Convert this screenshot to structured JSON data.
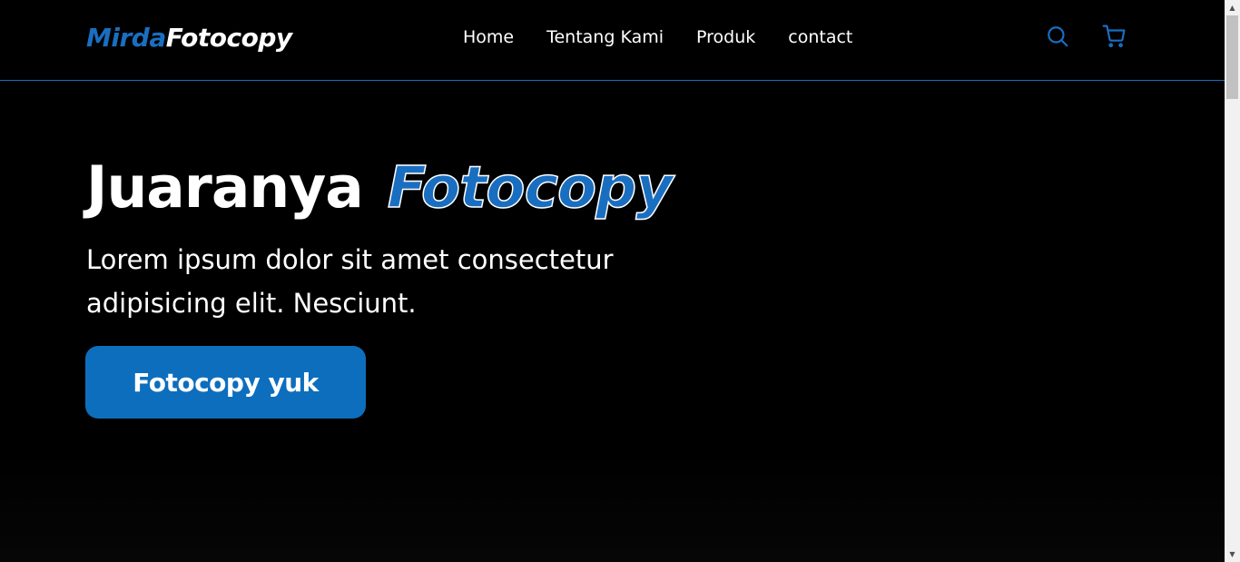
{
  "navbar": {
    "brand_part1": "Mirda",
    "brand_part2": "Fotocopy",
    "links": [
      {
        "label": "Home"
      },
      {
        "label": "Tentang Kami"
      },
      {
        "label": "Produk"
      },
      {
        "label": "contact"
      }
    ],
    "icons": [
      "search-icon",
      "shopping-cart-icon"
    ]
  },
  "hero": {
    "title_part1": "Juaranya",
    "title_part2": "Fotocopy",
    "text": "Lorem ipsum dolor sit amet consectetur adipisicing elit. Nesciunt.",
    "cta_label": "Fotocopy yuk"
  },
  "colors": {
    "accent": "#1a6ec0",
    "button": "#0d6ebd",
    "background": "#000000",
    "text": "#ffffff"
  }
}
